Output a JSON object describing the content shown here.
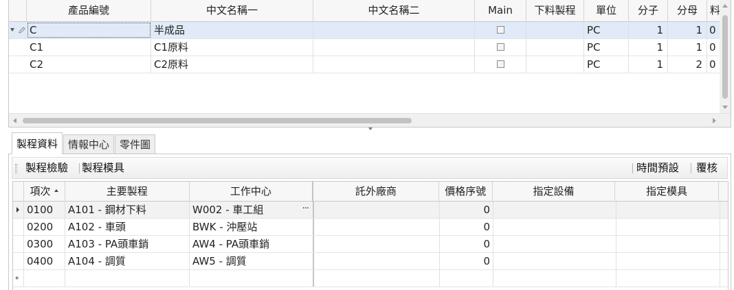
{
  "top_grid": {
    "columns": [
      "產品編號",
      "中文名稱一",
      "中文名稱二",
      "Main",
      "下料製程",
      "單位",
      "分子",
      "分母",
      "料"
    ],
    "rows": [
      {
        "code": "C",
        "name1": "半成品",
        "name2": "",
        "main": false,
        "process": "",
        "unit": "PC",
        "numerator": "1",
        "denominator": "1",
        "extra": "0"
      },
      {
        "code": "C1",
        "name1": "C1原料",
        "name2": "",
        "main": false,
        "process": "",
        "unit": "PC",
        "numerator": "1",
        "denominator": "1",
        "extra": "0"
      },
      {
        "code": "C2",
        "name1": "C2原料",
        "name2": "",
        "main": false,
        "process": "",
        "unit": "PC",
        "numerator": "1",
        "denominator": "2",
        "extra": "0"
      }
    ]
  },
  "tabs": [
    "製程資料",
    "情報中心",
    "零件圖"
  ],
  "toolbar": {
    "left": [
      "製程檢驗",
      "製程模具"
    ],
    "right": [
      "時間預設",
      "覆核"
    ]
  },
  "lower_grid": {
    "columns": [
      "項次",
      "主要製程",
      "工作中心",
      "託外廠商",
      "價格序號",
      "指定設備",
      "指定模具"
    ],
    "rows": [
      {
        "item": "0100",
        "process": "A101 - 鋼材下料",
        "center": "W002 - 車工組",
        "vendor": "",
        "price_no": "0",
        "equipment": "",
        "mold": ""
      },
      {
        "item": "0200",
        "process": "A102 - 車頭",
        "center": "BWK - 沖壓站",
        "vendor": "",
        "price_no": "0",
        "equipment": "",
        "mold": ""
      },
      {
        "item": "0300",
        "process": "A103 - PA頭車銷",
        "center": "AW4 - PA頭車銷",
        "vendor": "",
        "price_no": "0",
        "equipment": "",
        "mold": ""
      },
      {
        "item": "0400",
        "process": "A104 - 調質",
        "center": "AW5 - 調質",
        "vendor": "",
        "price_no": "0",
        "equipment": "",
        "mold": ""
      }
    ],
    "new_row_marker": "*",
    "ellipsis": "···"
  }
}
